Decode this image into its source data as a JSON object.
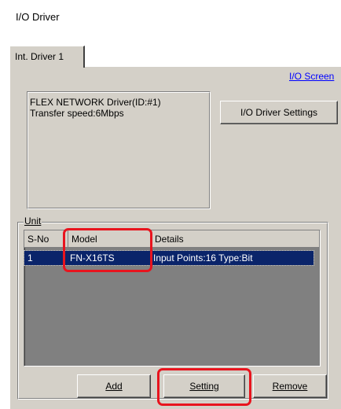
{
  "window": {
    "title": "I/O Driver"
  },
  "tab": {
    "label": "Int. Driver 1"
  },
  "link": {
    "label": "I/O Screen"
  },
  "driver_info": {
    "line1": "FLEX NETWORK Driver(ID:#1)",
    "line2": "Transfer speed:6Mbps"
  },
  "buttons": {
    "driver_settings": "I/O Driver Settings",
    "add": "Add",
    "setting": "Setting",
    "remove": "Remove"
  },
  "unit_group": {
    "label": "Unit"
  },
  "table": {
    "headers": [
      "S-No",
      "Model",
      "Details"
    ],
    "rows": [
      {
        "sno": "1",
        "model": "FN-X16TS",
        "details": "Input Points:16 Type:Bit",
        "selected": true
      }
    ]
  },
  "colors": {
    "panel": "#d4d0c8",
    "selection": "#0a246a",
    "highlight": "#e8141e",
    "link": "#0000ff"
  }
}
